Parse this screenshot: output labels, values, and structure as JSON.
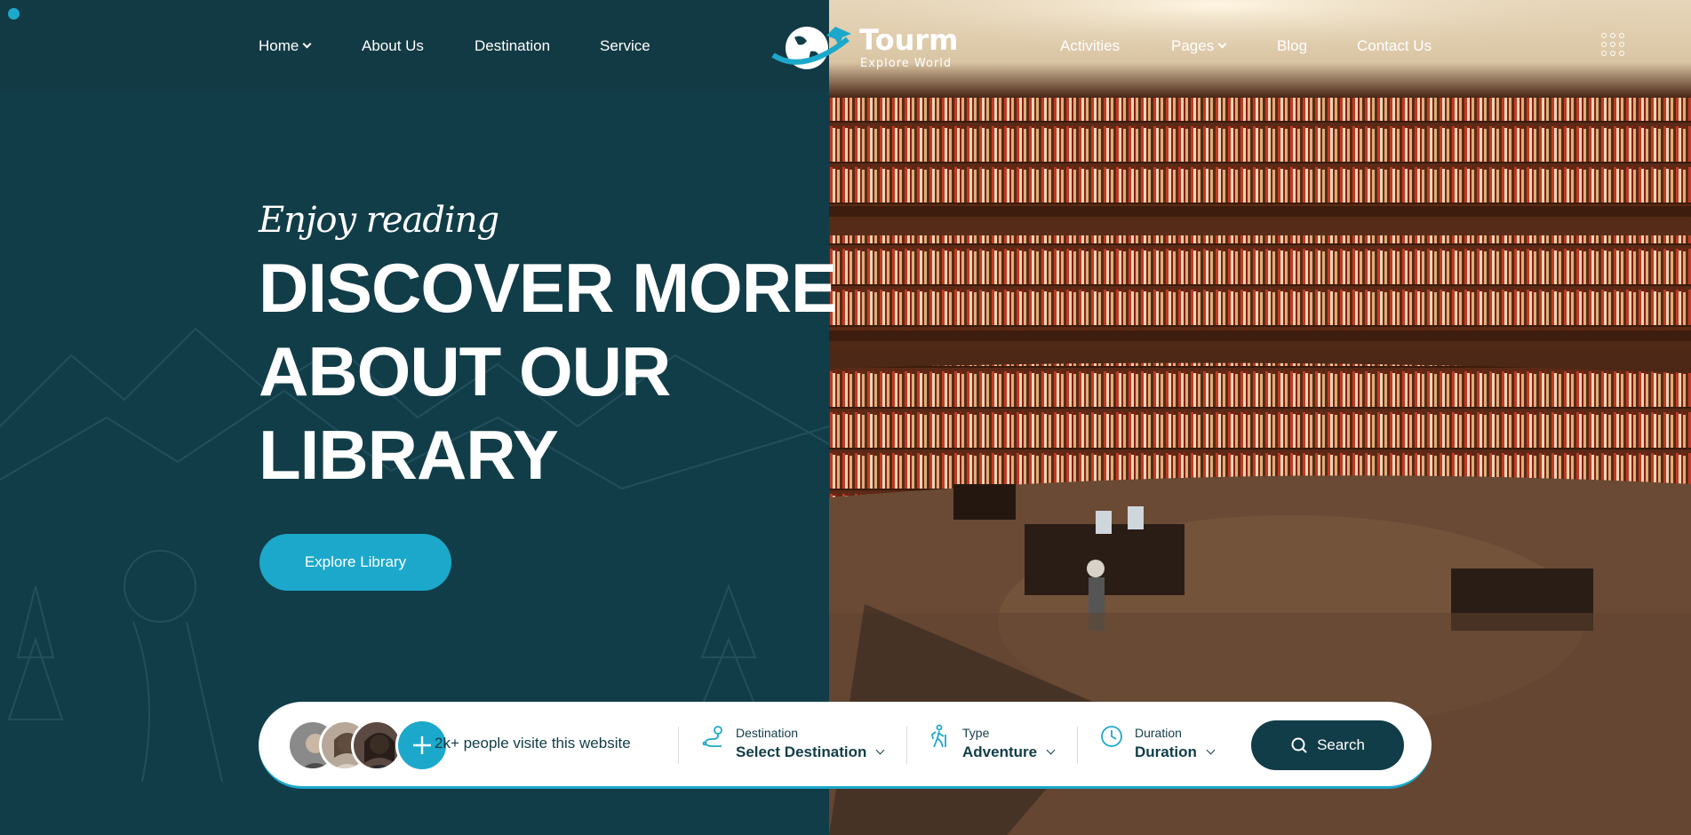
{
  "nav": {
    "left": [
      {
        "label": "Home",
        "has_dropdown": true
      },
      {
        "label": "About Us"
      },
      {
        "label": "Destination"
      },
      {
        "label": "Service"
      }
    ],
    "right": [
      {
        "label": "Activities"
      },
      {
        "label": "Pages",
        "has_dropdown": true
      },
      {
        "label": "Blog"
      },
      {
        "label": "Contact Us"
      }
    ]
  },
  "logo": {
    "title": "Tourm",
    "subtitle": "Explore World"
  },
  "hero": {
    "subtitle": "Enjoy reading",
    "title_lines": [
      "DISCOVER MORE",
      "ABOUT OUR",
      "LIBRARY"
    ],
    "cta_label": "Explore Library"
  },
  "search_bar": {
    "visitors_text": "2k+ people visite this website",
    "fields": [
      {
        "label": "Destination",
        "value": "Select Destination",
        "icon": "map-route-icon"
      },
      {
        "label": "Type",
        "value": "Adventure",
        "icon": "hiker-icon"
      },
      {
        "label": "Duration",
        "value": "Duration",
        "icon": "clock-icon"
      }
    ],
    "search_label": "Search"
  },
  "colors": {
    "primary_dark": "#113d48",
    "accent": "#1ca8cb",
    "white": "#ffffff"
  }
}
